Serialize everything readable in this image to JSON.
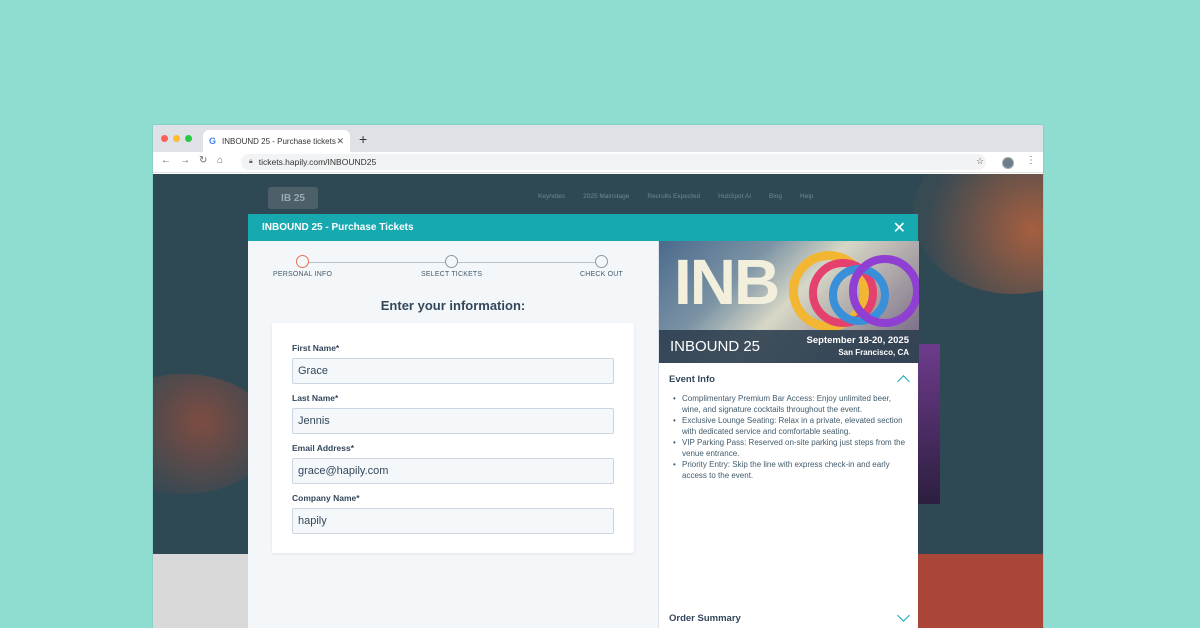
{
  "browser": {
    "tab_title": "INBOUND 25 - Purchase tickets",
    "url": "tickets.hapily.com/INBOUND25",
    "dot_colors": [
      "#ff5f57",
      "#febc2e",
      "#28c840"
    ]
  },
  "site": {
    "logo": "IB 25",
    "nav": [
      "Keynotes",
      "2025 Mainstage",
      "Recruits Expected",
      "HubSpot AI",
      "Blog",
      "Help"
    ]
  },
  "modal": {
    "title": "INBOUND 25 - Purchase Tickets",
    "steps": [
      "PERSONAL INFO",
      "SELECT TICKETS",
      "CHECK OUT"
    ],
    "form_title": "Enter your information:",
    "fields": [
      {
        "label": "First Name*",
        "value": "Grace"
      },
      {
        "label": "Last Name*",
        "value": "Jennis"
      },
      {
        "label": "Email Address*",
        "value": "grace@hapily.com"
      },
      {
        "label": "Company Name*",
        "value": "hapily"
      }
    ]
  },
  "event": {
    "name": "INBOUND 25",
    "date": "September 18-20, 2025",
    "location": "San Francisco, CA",
    "info_heading": "Event Info",
    "info_items": [
      "Complimentary Premium Bar Access: Enjoy unlimited beer, wine, and signature cocktails throughout the event.",
      "Exclusive Lounge Seating: Relax in a private, elevated section with dedicated service and comfortable seating.",
      "VIP Parking Pass: Reserved on-site parking just steps from the venue entrance.",
      "Priority Entry: Skip the line with express check-in and early access to the event."
    ],
    "order_heading": "Order Summary"
  },
  "colors": {
    "accent": "#16a9b0",
    "active_step": "#e6734e",
    "background": "#8fdcd0"
  }
}
